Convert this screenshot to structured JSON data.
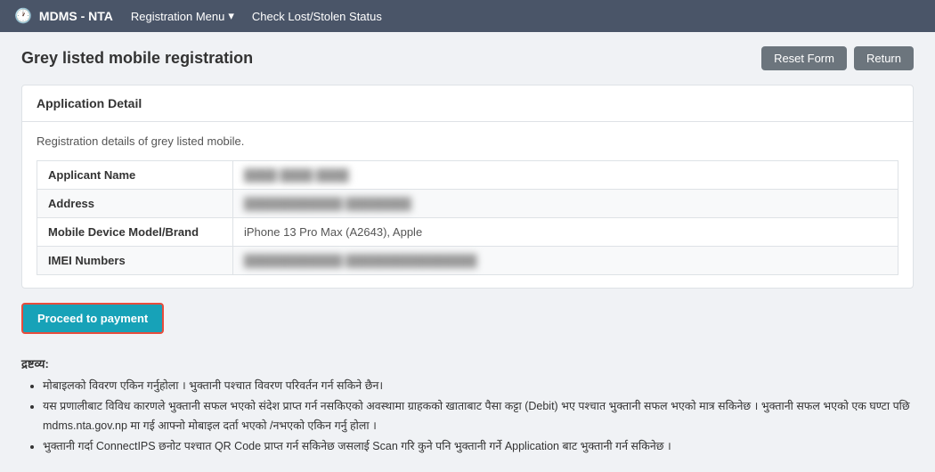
{
  "navbar": {
    "brand": "MDMS - NTA",
    "menu_label": "Registration Menu",
    "menu_arrow": "▾",
    "check_link": "Check Lost/Stolen Status"
  },
  "page": {
    "title": "Grey listed mobile registration",
    "reset_button": "Reset Form",
    "return_button": "Return"
  },
  "card": {
    "header": "Application Detail",
    "description": "Registration details of grey listed mobile.",
    "fields": [
      {
        "label": "Applicant Name",
        "value": "████ ████ ████",
        "blurred": true
      },
      {
        "label": "Address",
        "value": "████████████ ████████",
        "blurred": true
      },
      {
        "label": "Mobile Device Model/Brand",
        "value": "iPhone 13 Pro Max (A2643), Apple",
        "blurred": false
      },
      {
        "label": "IMEI Numbers",
        "value": "████████████ ████████████████",
        "blurred": true
      }
    ]
  },
  "proceed_button": "Proceed to payment",
  "notes": {
    "title": "द्रष्टव्य:",
    "items": [
      "मोबाइलको विवरण एकिन गर्नुहोला । भुक्तानी पश्चात विवरण परिवर्तन गर्न सकिने छैन।",
      "यस प्रणालीबाट विविध कारणले भुक्तानी सफल भएको संदेश प्राप्त गर्न नसकिएको अवस्थामा ग्राहकको खाताबाट पैसा कट्टा (Debit) भए पश्चात भुक्तानी सफल भएको मात्र सकिनेछ । भुक्तानी सफल भएको एक घण्टा पछि mdms.nta.gov.np मा गई आफ्नो मोबाइल दर्ता भएको /नभएको एकिन गर्नु होला ।",
      "भुक्तानी गर्दा ConnectIPS छनोट पश्चात QR Code प्राप्त गर्न सकिनेछ जसलाई Scan गरि कुने पनि भुक्तानी गर्ने Application बाट भुक्तानी गर्न सकिनेछ ।"
    ]
  },
  "icons": {
    "clock": "🕐"
  }
}
